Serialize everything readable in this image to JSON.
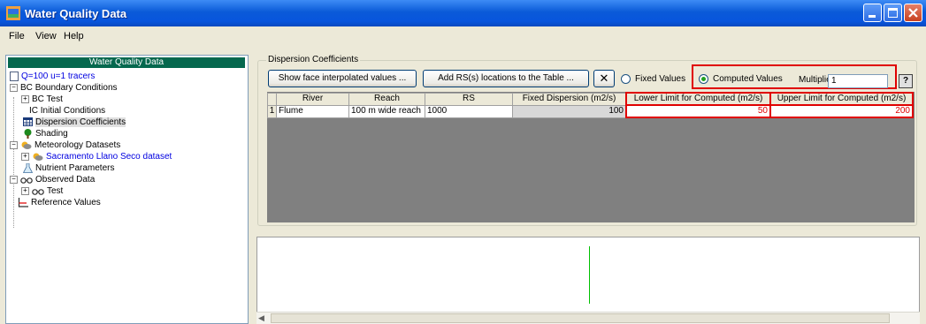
{
  "window": {
    "title": "Water Quality Data",
    "icon": "app-window-icon"
  },
  "menu": [
    "File",
    "View",
    "Help"
  ],
  "tree": {
    "header": "Water Quality Data",
    "items": [
      {
        "label": "Q=100 u=1 tracers",
        "prefix": "",
        "expander": "",
        "icon": "document-icon",
        "blue": true
      },
      {
        "label": "Boundary Conditions",
        "prefix": "BC",
        "expander": "−",
        "icon": ""
      },
      {
        "label": "Test",
        "prefix": "BC",
        "expander": "+",
        "icon": ""
      },
      {
        "label": "Initial Conditions",
        "prefix": "IC",
        "expander": "",
        "icon": ""
      },
      {
        "label": "Dispersion Coefficients",
        "prefix": "",
        "expander": "",
        "icon": "table-icon",
        "selected": true
      },
      {
        "label": "Shading",
        "prefix": "",
        "expander": "",
        "icon": "tree-icon"
      },
      {
        "label": "Meteorology Datasets",
        "prefix": "",
        "expander": "−",
        "icon": "weather-icon"
      },
      {
        "label": "Sacramento Llano Seco dataset",
        "prefix": "",
        "expander": "+",
        "icon": "weather-icon",
        "blue": true
      },
      {
        "label": "Nutrient Parameters",
        "prefix": "",
        "expander": "",
        "icon": "flask-icon"
      },
      {
        "label": "Observed Data",
        "prefix": "",
        "expander": "−",
        "icon": "glasses-icon"
      },
      {
        "label": "Test",
        "prefix": "",
        "expander": "+",
        "icon": "glasses-icon"
      },
      {
        "label": "Reference Values",
        "prefix": "",
        "expander": "",
        "icon": "axes-icon"
      }
    ]
  },
  "dispersion": {
    "group_label": "Dispersion Coefficients",
    "show_face_button": "Show face interpolated values ...",
    "add_rs_button": "Add RS(s) locations to the Table ...",
    "delete_icon": "✕",
    "fixed_values_label": "Fixed Values",
    "computed_values_label": "Computed Values",
    "selected_mode": "Computed Values",
    "multiplier_label": "Multiplier:",
    "multiplier_value": "1",
    "help_label": "?"
  },
  "table": {
    "columns": [
      "River",
      "Reach",
      "RS",
      "Fixed Dispersion (m2/s)",
      "Lower Limit for Computed (m2/s)",
      "Upper Limit for Computed (m2/s)"
    ],
    "rows": [
      {
        "num": "1",
        "river": "Flume",
        "reach": "100 m wide reach",
        "rs": "1000",
        "fixed": "100",
        "lower": "50",
        "upper": "200"
      }
    ]
  },
  "colors": {
    "highlight": "#E00000",
    "tree_header": "#05684E",
    "plot_line": "#00C000"
  }
}
